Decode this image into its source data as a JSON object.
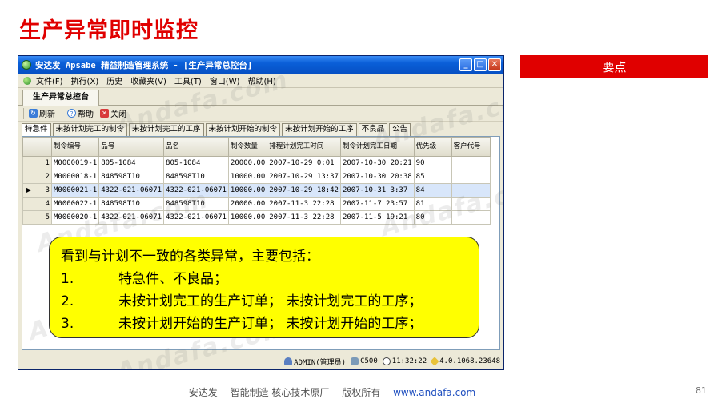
{
  "slide": {
    "title": "生产异常即时监控",
    "keypoint_label": "要点",
    "footer": {
      "company": "安达发",
      "tagline": "智能制造 核心技术原厂",
      "copyright": "版权所有",
      "url": "www.andafa.com"
    },
    "page_number": "81"
  },
  "app": {
    "window_title": "安达发 Apsabe 精益制造管理系统 - [生产异常总控台]",
    "menu": [
      "文件(F)",
      "执行(X)",
      "历史",
      "收藏夹(V)",
      "工具(T)",
      "窗口(W)",
      "帮助(H)"
    ],
    "doc_tab": "生产异常总控台",
    "toolbar": {
      "refresh": "刷新",
      "help": "帮助",
      "close": "关闭"
    },
    "filter_tabs": [
      "特急件",
      "未按计划完工的制令",
      "未按计划完工的工序",
      "未按计划开始的制令",
      "未按计划开始的工序",
      "不良品",
      "公告"
    ],
    "active_filter_tab": 0,
    "grid": {
      "columns": [
        "制令编号",
        "品号",
        "品名",
        "制令数量",
        "排程计划完工时间",
        "制令计划完工日期",
        "优先级",
        "客户代号"
      ],
      "rows": [
        {
          "n": "1",
          "cells": [
            "M0000019-1",
            "805-1084",
            "805-1084",
            "20000.00",
            "2007-10-29 0:01",
            "2007-10-30 20:21",
            "90",
            ""
          ]
        },
        {
          "n": "2",
          "cells": [
            "M0000018-1",
            "848598T10",
            "848598T10",
            "10000.00",
            "2007-10-29 13:37",
            "2007-10-30 20:38",
            "85",
            ""
          ]
        },
        {
          "n": "3",
          "cells": [
            "M0000021-1",
            "4322-021-06071",
            "4322-021-06071",
            "10000.00",
            "2007-10-29 18:42",
            "2007-10-31 3:37",
            "84",
            ""
          ],
          "selected": true
        },
        {
          "n": "4",
          "cells": [
            "M0000022-1",
            "848598T10",
            "848598T10",
            "20000.00",
            "2007-11-3 22:28",
            "2007-11-7 23:57",
            "81",
            ""
          ]
        },
        {
          "n": "5",
          "cells": [
            "M0000020-1",
            "4322-021-06071",
            "4322-021-06071",
            "10000.00",
            "2007-11-3 22:28",
            "2007-11-5 19:21",
            "80",
            ""
          ]
        }
      ]
    },
    "status": {
      "user": "ADMIN(管理员)",
      "db": "C500",
      "time": "11:32:22",
      "version": "4.0.1068.23648"
    },
    "watermark": "Andafa.com"
  },
  "callout": {
    "intro": "看到与计划不一致的各类异常，主要包括：",
    "items": [
      {
        "num": "1.",
        "text": "特急件、不良品；"
      },
      {
        "num": "2.",
        "text": "未按计划完工的生产订单；  未按计划完工的工序；"
      },
      {
        "num": "3.",
        "text": "未按计划开始的生产订单；  未按计划开始的工序；"
      }
    ]
  },
  "colors": {
    "title_red": "#e00000",
    "callout_yellow": "#ffff00",
    "titlebar_blue": "#0a5fd8",
    "link_blue": "#1f4fbf"
  }
}
